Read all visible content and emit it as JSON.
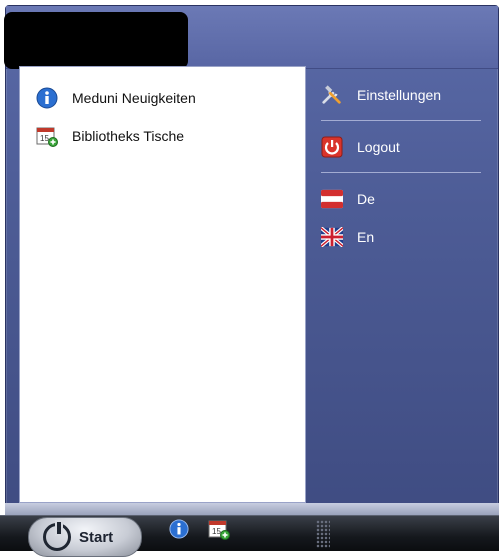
{
  "left_menu": {
    "items": [
      {
        "label": "Meduni Neuigkeiten",
        "icon": "info-icon"
      },
      {
        "label": "Bibliotheks Tische",
        "icon": "calendar-add-icon"
      }
    ]
  },
  "right_menu": {
    "settings_label": "Einstellungen",
    "logout_label": "Logout",
    "lang_de_label": "De",
    "lang_en_label": "En"
  },
  "taskbar": {
    "start_label": "Start",
    "pinned": [
      "info-icon",
      "calendar-add-icon"
    ]
  },
  "colors": {
    "accent": "#4d5c96",
    "info_blue": "#2b6fd1",
    "logout_red": "#d9342b"
  }
}
